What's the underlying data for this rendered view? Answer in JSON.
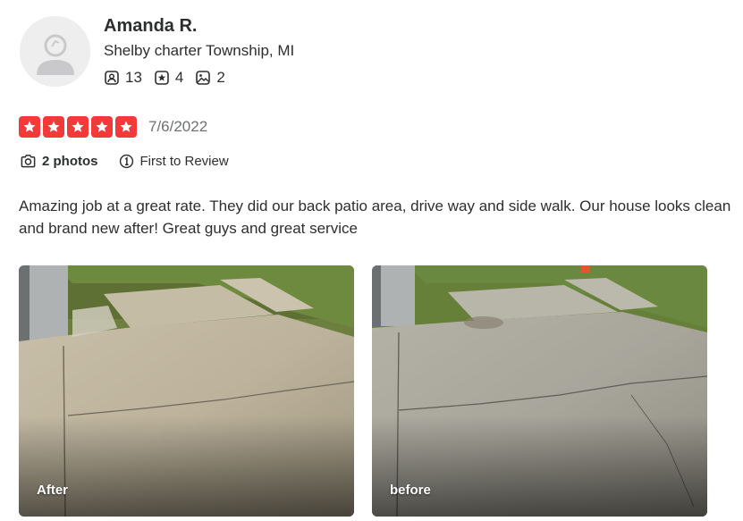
{
  "reviewer": {
    "name": "Amanda R.",
    "location": "Shelby charter Township, MI",
    "stats": {
      "friends": "13",
      "reviews": "4",
      "photos": "2"
    },
    "avatar_icon": "default-user-avatar"
  },
  "review": {
    "rating": 5,
    "rating_max": 5,
    "date": "7/6/2022",
    "photos_label": "2 photos",
    "badge_label": "First to Review",
    "text": "Amazing job at a great rate. They did our back patio area, drive way and side walk. Our house looks clean and brand new after! Great guys and great service"
  },
  "photos": [
    {
      "caption": "After"
    },
    {
      "caption": "before"
    }
  ],
  "colors": {
    "star_red": "#f43939",
    "text": "#2d2e2f",
    "muted": "#6e7072"
  }
}
